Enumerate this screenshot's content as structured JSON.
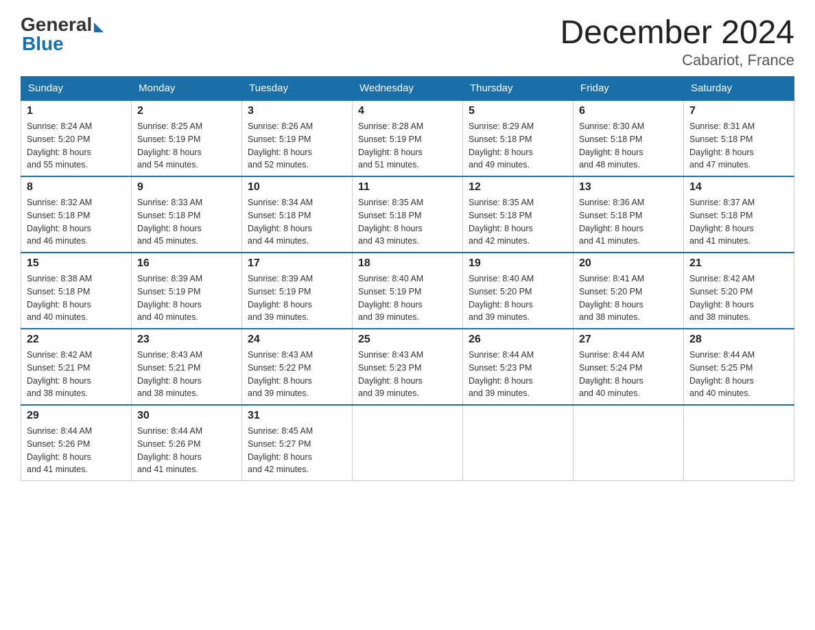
{
  "header": {
    "logo": {
      "general": "General",
      "blue": "Blue"
    },
    "title": "December 2024",
    "subtitle": "Cabariot, France"
  },
  "days_of_week": [
    "Sunday",
    "Monday",
    "Tuesday",
    "Wednesday",
    "Thursday",
    "Friday",
    "Saturday"
  ],
  "weeks": [
    [
      {
        "day": 1,
        "sunrise": "8:24 AM",
        "sunset": "5:20 PM",
        "daylight": "8 hours and 55 minutes."
      },
      {
        "day": 2,
        "sunrise": "8:25 AM",
        "sunset": "5:19 PM",
        "daylight": "8 hours and 54 minutes."
      },
      {
        "day": 3,
        "sunrise": "8:26 AM",
        "sunset": "5:19 PM",
        "daylight": "8 hours and 52 minutes."
      },
      {
        "day": 4,
        "sunrise": "8:28 AM",
        "sunset": "5:19 PM",
        "daylight": "8 hours and 51 minutes."
      },
      {
        "day": 5,
        "sunrise": "8:29 AM",
        "sunset": "5:18 PM",
        "daylight": "8 hours and 49 minutes."
      },
      {
        "day": 6,
        "sunrise": "8:30 AM",
        "sunset": "5:18 PM",
        "daylight": "8 hours and 48 minutes."
      },
      {
        "day": 7,
        "sunrise": "8:31 AM",
        "sunset": "5:18 PM",
        "daylight": "8 hours and 47 minutes."
      }
    ],
    [
      {
        "day": 8,
        "sunrise": "8:32 AM",
        "sunset": "5:18 PM",
        "daylight": "8 hours and 46 minutes."
      },
      {
        "day": 9,
        "sunrise": "8:33 AM",
        "sunset": "5:18 PM",
        "daylight": "8 hours and 45 minutes."
      },
      {
        "day": 10,
        "sunrise": "8:34 AM",
        "sunset": "5:18 PM",
        "daylight": "8 hours and 44 minutes."
      },
      {
        "day": 11,
        "sunrise": "8:35 AM",
        "sunset": "5:18 PM",
        "daylight": "8 hours and 43 minutes."
      },
      {
        "day": 12,
        "sunrise": "8:35 AM",
        "sunset": "5:18 PM",
        "daylight": "8 hours and 42 minutes."
      },
      {
        "day": 13,
        "sunrise": "8:36 AM",
        "sunset": "5:18 PM",
        "daylight": "8 hours and 41 minutes."
      },
      {
        "day": 14,
        "sunrise": "8:37 AM",
        "sunset": "5:18 PM",
        "daylight": "8 hours and 41 minutes."
      }
    ],
    [
      {
        "day": 15,
        "sunrise": "8:38 AM",
        "sunset": "5:18 PM",
        "daylight": "8 hours and 40 minutes."
      },
      {
        "day": 16,
        "sunrise": "8:39 AM",
        "sunset": "5:19 PM",
        "daylight": "8 hours and 40 minutes."
      },
      {
        "day": 17,
        "sunrise": "8:39 AM",
        "sunset": "5:19 PM",
        "daylight": "8 hours and 39 minutes."
      },
      {
        "day": 18,
        "sunrise": "8:40 AM",
        "sunset": "5:19 PM",
        "daylight": "8 hours and 39 minutes."
      },
      {
        "day": 19,
        "sunrise": "8:40 AM",
        "sunset": "5:20 PM",
        "daylight": "8 hours and 39 minutes."
      },
      {
        "day": 20,
        "sunrise": "8:41 AM",
        "sunset": "5:20 PM",
        "daylight": "8 hours and 38 minutes."
      },
      {
        "day": 21,
        "sunrise": "8:42 AM",
        "sunset": "5:20 PM",
        "daylight": "8 hours and 38 minutes."
      }
    ],
    [
      {
        "day": 22,
        "sunrise": "8:42 AM",
        "sunset": "5:21 PM",
        "daylight": "8 hours and 38 minutes."
      },
      {
        "day": 23,
        "sunrise": "8:43 AM",
        "sunset": "5:21 PM",
        "daylight": "8 hours and 38 minutes."
      },
      {
        "day": 24,
        "sunrise": "8:43 AM",
        "sunset": "5:22 PM",
        "daylight": "8 hours and 39 minutes."
      },
      {
        "day": 25,
        "sunrise": "8:43 AM",
        "sunset": "5:23 PM",
        "daylight": "8 hours and 39 minutes."
      },
      {
        "day": 26,
        "sunrise": "8:44 AM",
        "sunset": "5:23 PM",
        "daylight": "8 hours and 39 minutes."
      },
      {
        "day": 27,
        "sunrise": "8:44 AM",
        "sunset": "5:24 PM",
        "daylight": "8 hours and 40 minutes."
      },
      {
        "day": 28,
        "sunrise": "8:44 AM",
        "sunset": "5:25 PM",
        "daylight": "8 hours and 40 minutes."
      }
    ],
    [
      {
        "day": 29,
        "sunrise": "8:44 AM",
        "sunset": "5:26 PM",
        "daylight": "8 hours and 41 minutes."
      },
      {
        "day": 30,
        "sunrise": "8:44 AM",
        "sunset": "5:26 PM",
        "daylight": "8 hours and 41 minutes."
      },
      {
        "day": 31,
        "sunrise": "8:45 AM",
        "sunset": "5:27 PM",
        "daylight": "8 hours and 42 minutes."
      },
      null,
      null,
      null,
      null
    ]
  ]
}
